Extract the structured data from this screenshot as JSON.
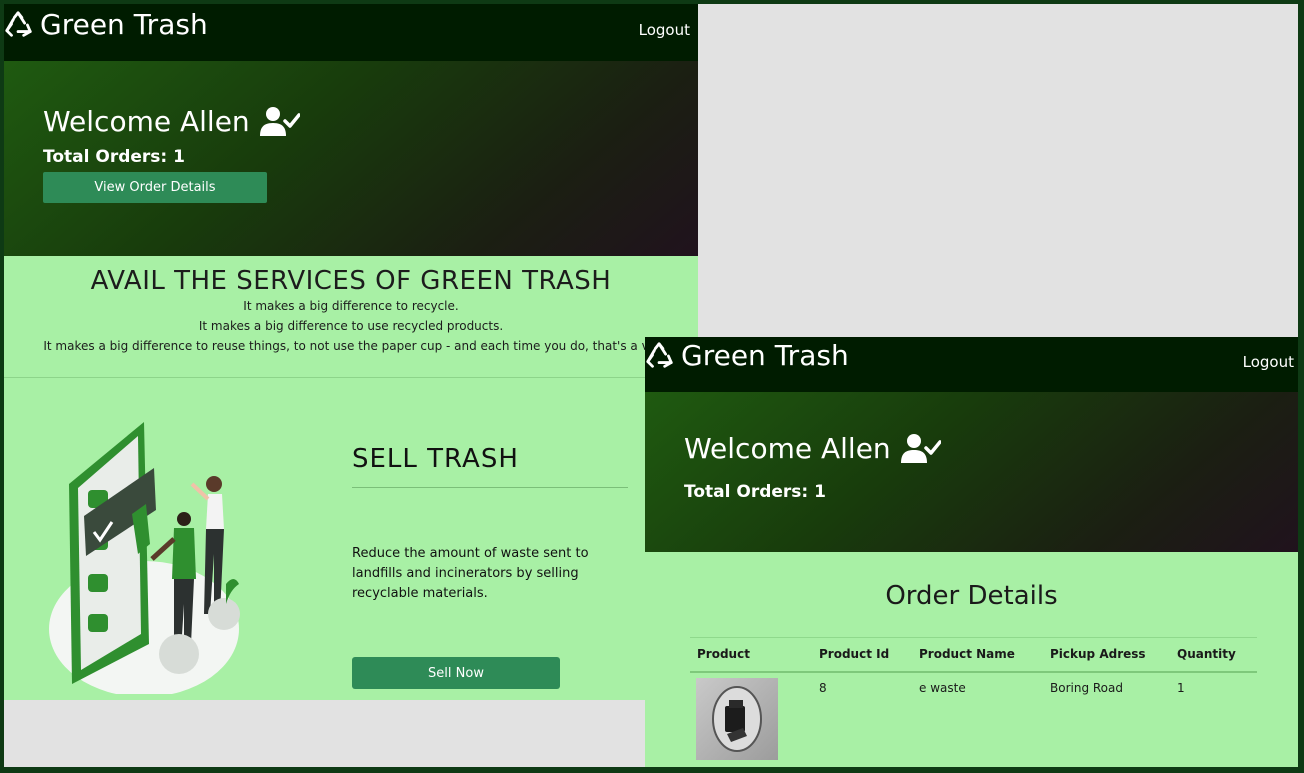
{
  "app": {
    "brand": "Green Trash",
    "logout_label": "Logout"
  },
  "dashboard": {
    "welcome": "Welcome Allen",
    "total_orders": "Total Orders: 1",
    "view_order_details_label": "View Order Details",
    "services_title": "AVAIL THE SERVICES OF GREEN TRASH",
    "services_lines": [
      "It makes a big difference to recycle.",
      "It makes a big difference to use recycled products.",
      "It makes a big difference to reuse things, to not use the paper cup - and each time you do, that's a vic"
    ],
    "sell_title": "SELL TRASH",
    "sell_description": "Reduce the amount of waste sent to landfills and incinerators by selling recyclable materials.",
    "sell_button": "Sell Now"
  },
  "order_page": {
    "welcome": "Welcome Allen",
    "total_orders": "Total Orders: 1",
    "title": "Order Details",
    "columns": [
      "Product",
      "Product Id",
      "Product Name",
      "Pickup Adress",
      "Quantity"
    ],
    "rows": [
      {
        "product_id": "8",
        "product_name": "e waste",
        "pickup_address": "Boring Road",
        "quantity": "1"
      }
    ]
  },
  "colors": {
    "navbar": "#001c00",
    "page_bg": "#a8f0a5",
    "button": "#2e8b57",
    "outer_frame": "#0e3a14",
    "backdrop": "#e2e2e2"
  },
  "icons": [
    "recycle-icon",
    "user-check-icon"
  ]
}
